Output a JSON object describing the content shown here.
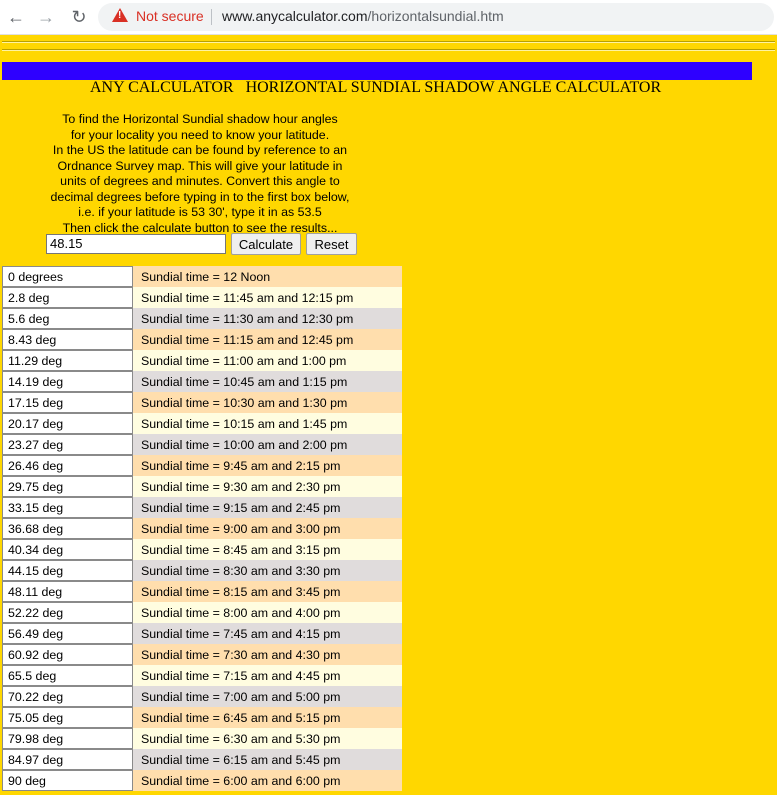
{
  "browser": {
    "security_label": "Not secure",
    "url_host": "www.anycalculator.com",
    "url_path": "/horizontalsundial.htm"
  },
  "page": {
    "title": "ANY CALCULATOR   HORIZONTAL SUNDIAL SHADOW ANGLE CALCULATOR",
    "intro_lines": [
      "To find the Horizontal Sundial shadow hour angles",
      "for your locality you need to know your latitude.",
      "In the US the latitude can be found by reference to an",
      "Ordnance Survey map. This will give your latitude in",
      "units of degrees and minutes. Convert this angle to",
      "decimal degrees before typing in to the first box below,",
      "i.e. if your latitude is 53 30', type it in as 53.5",
      "Then click the calculate button to see the results..."
    ],
    "latitude_value": "48.15",
    "calculate_label": "Calculate",
    "reset_label": "Reset",
    "accent_colors": {
      "background": "#ffd700",
      "bar": "#2e00ff"
    }
  },
  "results": [
    {
      "angle": "0 degrees",
      "time": "Sundial time = 12 Noon"
    },
    {
      "angle": "2.8 deg",
      "time": "Sundial time = 11:45 am and 12:15 pm"
    },
    {
      "angle": "5.6 deg",
      "time": "Sundial time = 11:30 am and 12:30 pm"
    },
    {
      "angle": "8.43 deg",
      "time": "Sundial time = 11:15 am and 12:45 pm"
    },
    {
      "angle": "11.29 deg",
      "time": "Sundial time = 11:00 am and 1:00 pm"
    },
    {
      "angle": "14.19 deg",
      "time": "Sundial time = 10:45 am and 1:15 pm"
    },
    {
      "angle": "17.15 deg",
      "time": "Sundial time = 10:30 am and 1:30 pm"
    },
    {
      "angle": "20.17 deg",
      "time": "Sundial time = 10:15 am and 1:45 pm"
    },
    {
      "angle": "23.27 deg",
      "time": "Sundial time = 10:00 am and 2:00 pm"
    },
    {
      "angle": "26.46 deg",
      "time": "Sundial time = 9:45 am and 2:15 pm"
    },
    {
      "angle": "29.75 deg",
      "time": "Sundial time = 9:30 am and 2:30 pm"
    },
    {
      "angle": "33.15 deg",
      "time": "Sundial time = 9:15 am and 2:45 pm"
    },
    {
      "angle": "36.68 deg",
      "time": "Sundial time = 9:00 am and 3:00 pm"
    },
    {
      "angle": "40.34 deg",
      "time": "Sundial time = 8:45 am and 3:15 pm"
    },
    {
      "angle": "44.15 deg",
      "time": "Sundial time = 8:30 am and 3:30 pm"
    },
    {
      "angle": "48.11 deg",
      "time": "Sundial time = 8:15 am and 3:45 pm"
    },
    {
      "angle": "52.22 deg",
      "time": "Sundial time = 8:00 am and 4:00 pm"
    },
    {
      "angle": "56.49 deg",
      "time": "Sundial time = 7:45 am and 4:15 pm"
    },
    {
      "angle": "60.92 deg",
      "time": "Sundial time = 7:30 am and 4:30 pm"
    },
    {
      "angle": "65.5 deg",
      "time": "Sundial time = 7:15 am and 4:45 pm"
    },
    {
      "angle": "70.22 deg",
      "time": "Sundial time = 7:00 am and 5:00 pm"
    },
    {
      "angle": "75.05 deg",
      "time": "Sundial time = 6:45 am and 5:15 pm"
    },
    {
      "angle": "79.98 deg",
      "time": "Sundial time = 6:30 am and 5:30 pm"
    },
    {
      "angle": "84.97 deg",
      "time": "Sundial time = 6:15 am and 5:45 pm"
    },
    {
      "angle": "90 deg",
      "time": "Sundial time = 6:00 am and 6:00 pm"
    }
  ]
}
